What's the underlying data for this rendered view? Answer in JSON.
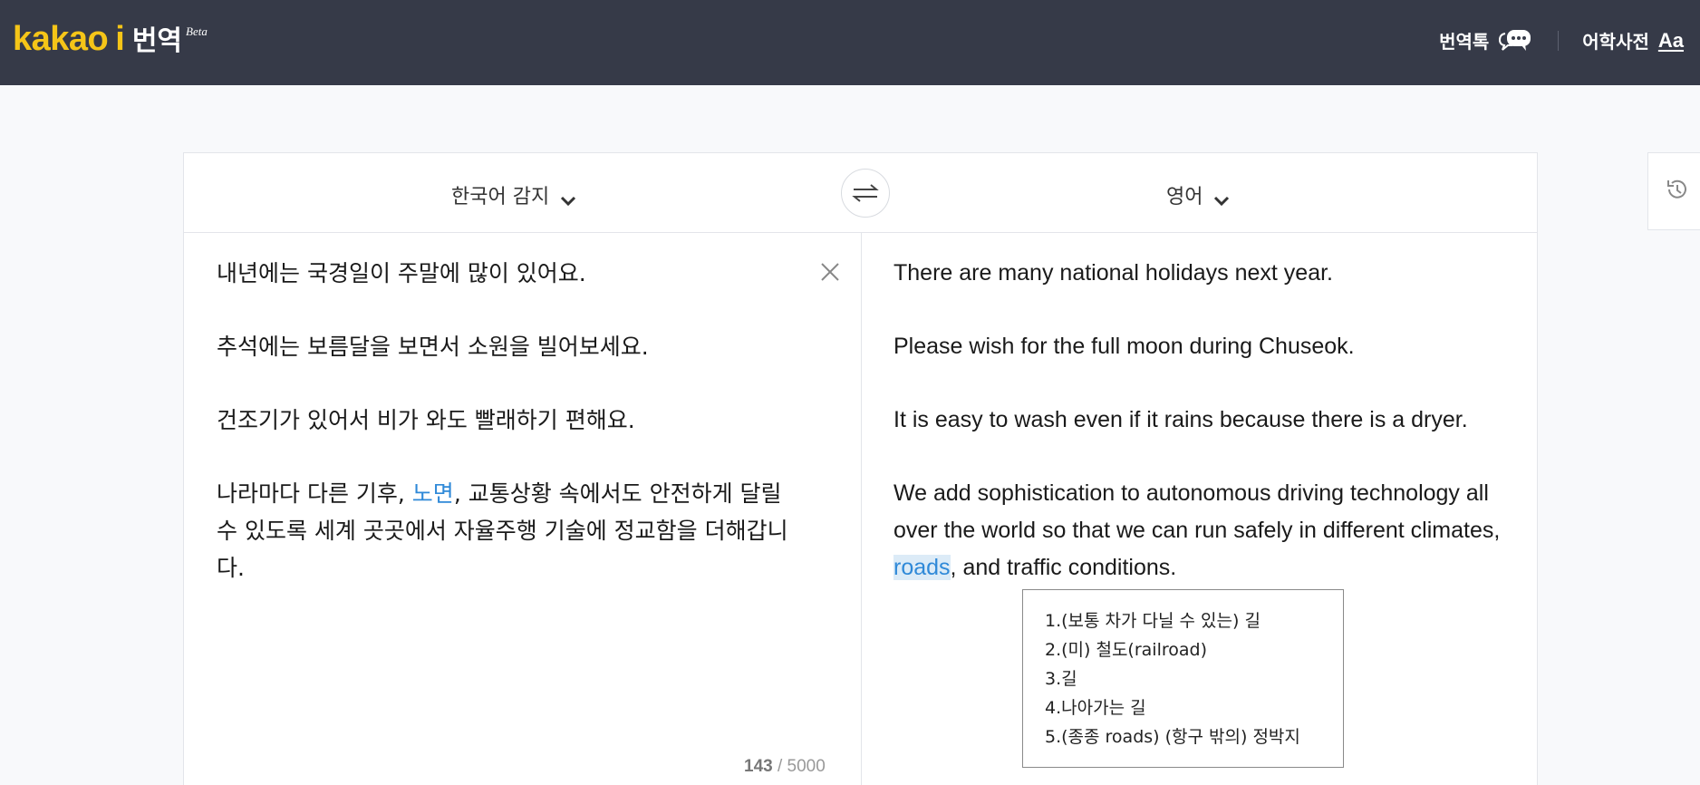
{
  "brand": {
    "kakao": "kakao",
    "i": "i",
    "service": "번역",
    "beta": "Beta"
  },
  "header": {
    "chat_label": "번역톡",
    "dict_label": "어학사전",
    "dict_icon": "Aa"
  },
  "languages": {
    "source": "한국어 감지",
    "target": "영어"
  },
  "source": {
    "paragraphs": [
      "내년에는 국경일이 주말에 많이 있어요.",
      "추석에는 보름달을 보면서 소원을 빌어보세요.",
      "건조기가 있어서 비가 와도 빨래하기 편해요."
    ],
    "last_before": "나라마다 다른 기후, ",
    "last_highlight": "노면",
    "last_after": ", 교통상황 속에서도 안전하게 달릴 수 있도록 세계 곳곳에서 자율주행 기술에 정교함을 더해갑니다."
  },
  "target": {
    "paragraphs": [
      "There are many national holidays next year.",
      "Please wish for the full moon during Chuseok.",
      "It is easy to wash even if it rains because there is a dryer."
    ],
    "last_before": "We add sophistication to autonomous driving technology all over the world so that we can run safely in different climates, ",
    "last_highlight": "roads",
    "last_after": ", and traffic conditions."
  },
  "counter": {
    "current": "143",
    "separator": " / ",
    "max": "5000"
  },
  "dictionary": {
    "entries": [
      "1.(보통 차가 다닐 수 있는) 길",
      "2.(미) 철도(railroad)",
      "3.길",
      "4.나아가는 길",
      "5.(종종 roads) (항구 밖의) 정박지"
    ]
  },
  "icons": {
    "chat": "speech-bubble-icon",
    "swap": "swap-arrows-icon",
    "clear": "close-icon",
    "history": "history-clock-icon"
  },
  "colors": {
    "header_bg": "#363a48",
    "brand_yellow": "#f5c518",
    "highlight_blue": "#2f89d8",
    "highlight_bg": "#dcebf7"
  }
}
